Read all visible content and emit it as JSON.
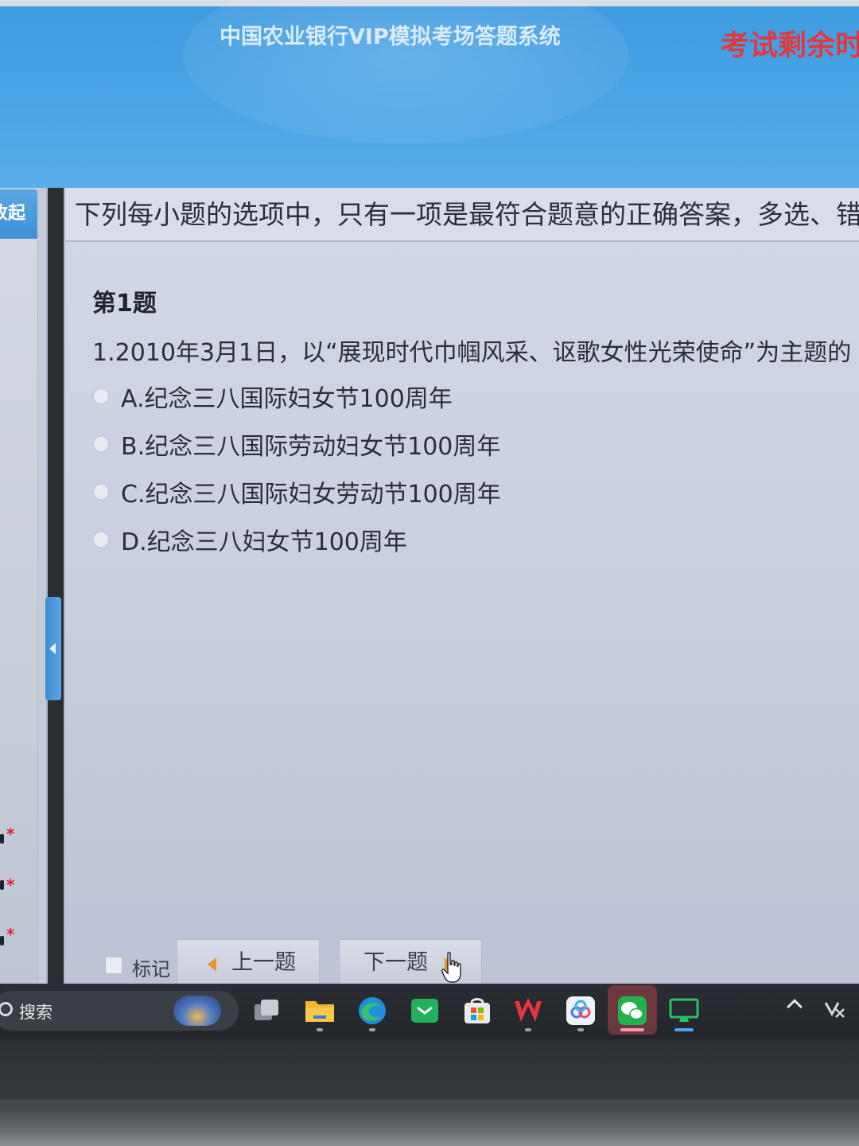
{
  "header": {
    "app_title": "中国农业银行VIP模拟考场答题系统",
    "timer_label": "考试剩余时"
  },
  "left_panel": {
    "collapse_label": "收起",
    "markers": [
      "*",
      "*",
      "*"
    ]
  },
  "exam": {
    "instructions": "下列每小题的选项中，只有一项是最符合题意的正确答案，多选、错选",
    "question_number": "第1题",
    "question_text": "1.2010年3月1日，以“展现时代巾帼风采、讴歌女性光荣使命”为主题的",
    "options": [
      {
        "label": "A.纪念三八国际妇女节100周年",
        "selected": false
      },
      {
        "label": "B.纪念三八国际劳动妇女节100周年",
        "selected": false
      },
      {
        "label": "C.纪念三八国际妇女劳动节100周年",
        "selected": false
      },
      {
        "label": "D.纪念三八妇女节100周年",
        "selected": false
      }
    ],
    "mark_label": "标记",
    "mark_checked": false,
    "prev_label": "上一题",
    "next_label": "下一题"
  },
  "taskbar": {
    "search_label": "搜索",
    "apps": [
      "task-view-icon",
      "file-explorer-icon",
      "edge-browser-icon",
      "email-app-icon",
      "microsoft-store-icon",
      "wps-office-icon",
      "cloud-drive-icon",
      "wechat-icon",
      "remote-desktop-icon"
    ],
    "tray": [
      "chevron-up-icon",
      "network-icon"
    ]
  },
  "colors": {
    "header_blue": "#4aa4e6",
    "timer_red": "#e2383d",
    "arrow_orange": "#e9932c"
  }
}
